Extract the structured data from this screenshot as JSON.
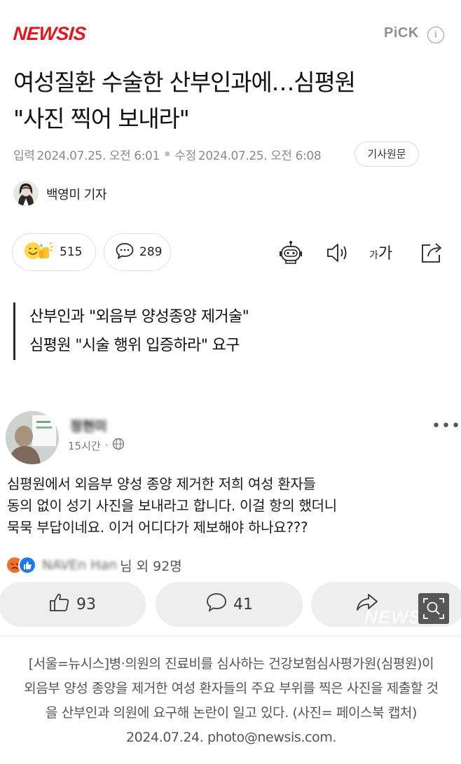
{
  "header": {
    "logo": "NEWSIS",
    "pick": "PiCK",
    "info_icon": "i"
  },
  "article": {
    "title_line1": "여성질환 수술한 산부인과에…심평원",
    "title_line2": "\"사진 찍어 보내라\"",
    "input_label": "입력",
    "input_date": "2024.07.25. 오전 6:01",
    "modify_label": "수정",
    "modify_date": "2024.07.25. 오전 6:08",
    "original_button": "기사원문",
    "reporter": "백영미 기자",
    "reactions_count": "515",
    "comments_count": "289",
    "font_small": "가",
    "font_large": "가",
    "subhead_line1": "산부인과 \"외음부 양성종양 제거술\"",
    "subhead_line2": "심평원 \"시술 행위 입증하라\" 요구"
  },
  "photo": {
    "fb_name": "정현미",
    "fb_time": "15시간",
    "fb_dot": "·",
    "fb_more": "•••",
    "post_line1": "심평원에서 외음부 양성 종양 제거한 저희 여성 환자들",
    "post_line2": "동의 없이 성기 사진을 보내라고 합니다. 이걸 항의 했더니",
    "post_line3": "묵묵 부답이네요. 이거 어디다가 제보해야 하나요???",
    "react_names": "NAVEn Han",
    "react_tail": "님 외 92명",
    "like_count": "93",
    "comment_count": "41",
    "watermark": "NEWSIS"
  },
  "caption": "[서울=뉴시스]병·의원의 진료비를 심사하는 건강보험심사평가원(심평원)이 외음부 양성 종양을 제거한 여성 환자들의 주요 부위를 찍은 사진을 제출할 것을 산부인과 의원에 요구해 논란이 일고 있다. (사진= 페이스북 캡처) 2024.07.24. photo@newsis.com.",
  "colors": {
    "brand": "#e4161e",
    "text": "#111111",
    "muted": "#8a8a8a",
    "fb_button_bg": "#eeeeee"
  }
}
